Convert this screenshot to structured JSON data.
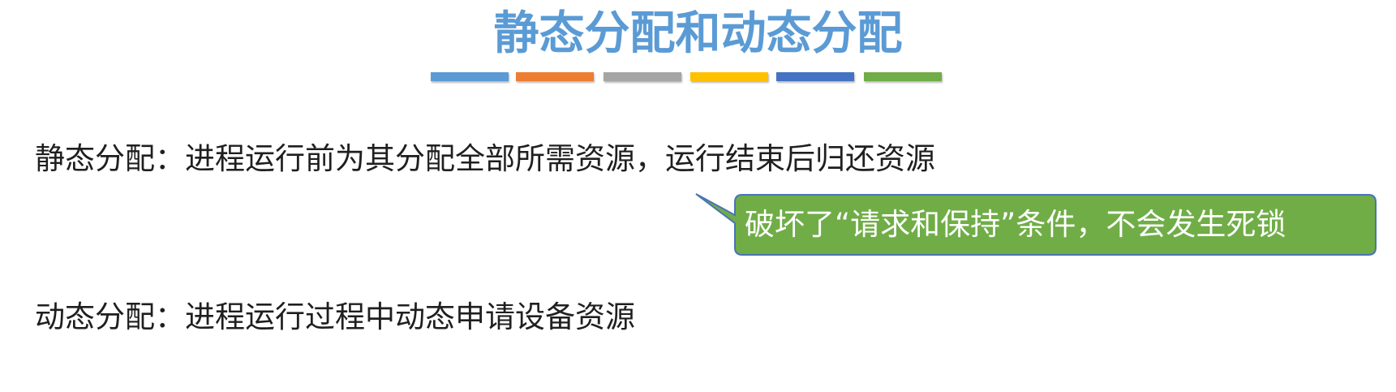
{
  "title": "静态分配和动态分配",
  "title_color": "#5b9bd5",
  "color_bars": [
    "#5b9bd5",
    "#ed7d31",
    "#a5a5a5",
    "#ffc000",
    "#4472c4",
    "#70ad47"
  ],
  "static_line": "静态分配：进程运行前为其分配全部所需资源，运行结束后归还资源",
  "callout": {
    "text": "破坏了“请求和保持”条件，不会发生死锁",
    "fill": "#70ad47",
    "border": "#4a73b5"
  },
  "dynamic_line": "动态分配：进程运行过程中动态申请设备资源"
}
